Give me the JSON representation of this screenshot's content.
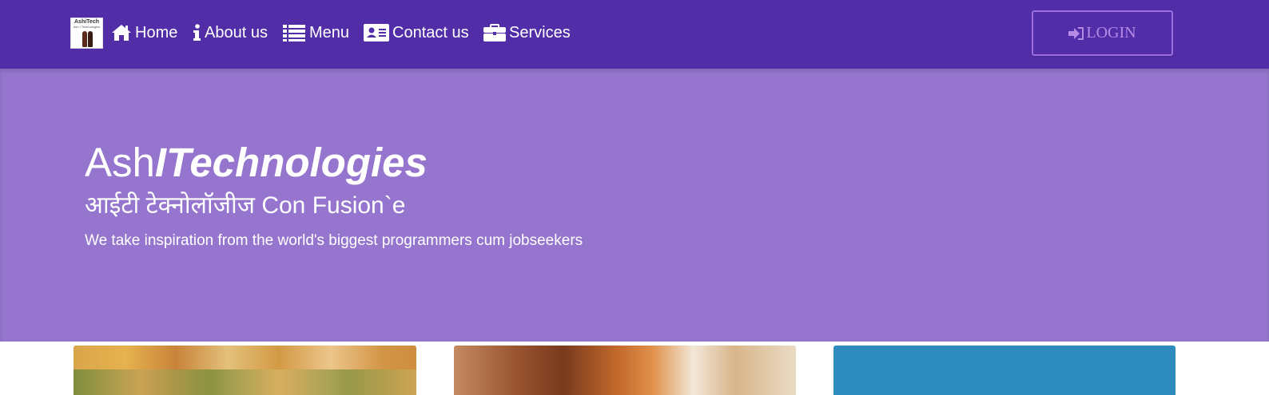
{
  "navbar": {
    "logo": {
      "line1": "AshiTech",
      "line2": "Ash I Technologies"
    },
    "items": [
      {
        "label": "Home",
        "icon": "home-icon"
      },
      {
        "label": "About us",
        "icon": "info-icon"
      },
      {
        "label": "Menu",
        "icon": "list-icon"
      },
      {
        "label": "Contact us",
        "icon": "address-card-icon"
      },
      {
        "label": "Services",
        "icon": "briefcase-icon"
      }
    ],
    "login_label": "LOGIN",
    "login_icon": "sign-in-icon"
  },
  "jumbotron": {
    "title_plain": "Ash",
    "title_italic": "ITechnologies",
    "subtitle": "आईटी टेक्नोलॉजीज Con Fusion`e",
    "tagline": "We take inspiration from the world's biggest programmers cum jobseekers"
  },
  "colors": {
    "navbar_bg": "#512da8",
    "jumbotron_bg": "#9575cd",
    "login_border": "#9c6ee0",
    "login_text": "#b58be6"
  }
}
